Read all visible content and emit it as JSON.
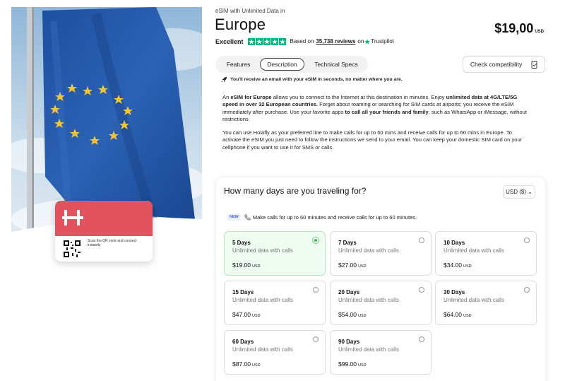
{
  "product": {
    "eyebrow": "eSIM with Unlimited Data in",
    "title": "Europe",
    "price": "$19,00",
    "price_unit": "USD"
  },
  "rating": {
    "label": "Excellent",
    "stars": 5,
    "based_on": "Based on",
    "reviews": "35,738 reviews",
    "on": "on",
    "platform": "Trustpilot",
    "star_color": "#00b67a"
  },
  "hero": {
    "card_caption": "Scan the QR code and connect instantly",
    "card_color": "#e2535f"
  },
  "tabs": [
    {
      "label": "Features"
    },
    {
      "label": "Description",
      "active": true
    },
    {
      "label": "Technical Specs"
    }
  ],
  "compatibility_button": "Check compatibility",
  "notice": "You'll receive an email with your eSIM in seconds, no matter where you are.",
  "description": {
    "p1_a": "An ",
    "p1_b": "eSIM for Europe",
    "p1_c": " allows you to connect to the Internet at this destination in minutes. Enjoy ",
    "p1_d": "unlimited data at 4G/LTE/5G speed in over 32 European countries.",
    "p1_e": " Forget about roaming or searching for SIM cards at airports; you receive the eSIM immediately after purchase. Use your favorite apps ",
    "p1_f": "to call all your friends and family",
    "p1_g": ", such as WhatsApp or iMessage, without restrictions.",
    "p2": "You can use Holafly as your preferred line to make calls for up to 60 mins and receive calls for up to 60 mins in Europe. To activate the eSIM you just need to follow the instructions we send to your email. You can keep your domestic SIM card on your cellphone if you want to use it for SMS or calls."
  },
  "days_panel": {
    "title": "How many days are you traveling for?",
    "currency": "USD ($)",
    "promo_badge": "NEW",
    "promo_text": "Make calls for up to 60 minutes and receive calls for up to 60 minutes.",
    "plans": [
      {
        "days": "5 Days",
        "desc": "Unlimited data with calls",
        "price": "$19.00",
        "unit": "USD",
        "selected": true
      },
      {
        "days": "7 Days",
        "desc": "Unlimited data with calls",
        "price": "$27.00",
        "unit": "USD",
        "selected": false
      },
      {
        "days": "10 Days",
        "desc": "Unlimited data with calls",
        "price": "$34.00",
        "unit": "USD",
        "selected": false
      },
      {
        "days": "15 Days",
        "desc": "Unlimited data with calls",
        "price": "$47.00",
        "unit": "USD",
        "selected": false
      },
      {
        "days": "20 Days",
        "desc": "Unlimited data with calls",
        "price": "$54.00",
        "unit": "USD",
        "selected": false
      },
      {
        "days": "30 Days",
        "desc": "Unlimited data with calls",
        "price": "$64.00",
        "unit": "USD",
        "selected": false
      },
      {
        "days": "60 Days",
        "desc": "Unlimited data with calls",
        "price": "$87.00",
        "unit": "USD",
        "selected": false
      },
      {
        "days": "90 Days",
        "desc": "Unlimited data with calls",
        "price": "$99.00",
        "unit": "USD",
        "selected": false
      }
    ]
  }
}
